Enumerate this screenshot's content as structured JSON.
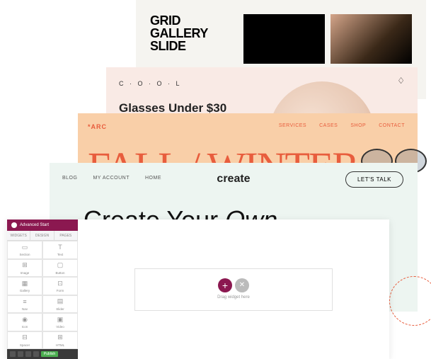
{
  "card1": {
    "title_l1": "GRID",
    "title_l2": "GALLERY",
    "title_l3": "SLIDE"
  },
  "card2": {
    "logo": "C · O · O · L",
    "bag": "♢",
    "headline": "Glasses Under $30"
  },
  "card3": {
    "brand": "*ARC",
    "nav": [
      "SERVICES",
      "CASES",
      "SHOP",
      "CONTACT"
    ],
    "big": "FALL / WINTER"
  },
  "card4": {
    "nav": [
      "BLOG",
      "MY ACCOUNT",
      "HOME"
    ],
    "logo": "create",
    "cta": "LET'S TALK",
    "hero_plain": "Create Your ",
    "hero_em": "Own"
  },
  "builder": {
    "topbar": "Advanced Start",
    "tabs": [
      "WIDGETS",
      "DESIGN",
      "PAGES"
    ],
    "widgets": [
      {
        "icon": "▭",
        "label": "Section"
      },
      {
        "icon": "T",
        "label": "Text"
      },
      {
        "icon": "⊞",
        "label": "Image"
      },
      {
        "icon": "▢",
        "label": "Button"
      },
      {
        "icon": "▦",
        "label": "Gallery"
      },
      {
        "icon": "⊡",
        "label": "Form"
      },
      {
        "icon": "≡",
        "label": "Nav"
      },
      {
        "icon": "▤",
        "label": "Slider"
      },
      {
        "icon": "◉",
        "label": "Icon"
      },
      {
        "icon": "▣",
        "label": "Video"
      },
      {
        "icon": "⊟",
        "label": "Spacer"
      },
      {
        "icon": "⊞",
        "label": "HTML"
      }
    ],
    "dropzone": "Drag widget here",
    "publish": "Publish"
  }
}
